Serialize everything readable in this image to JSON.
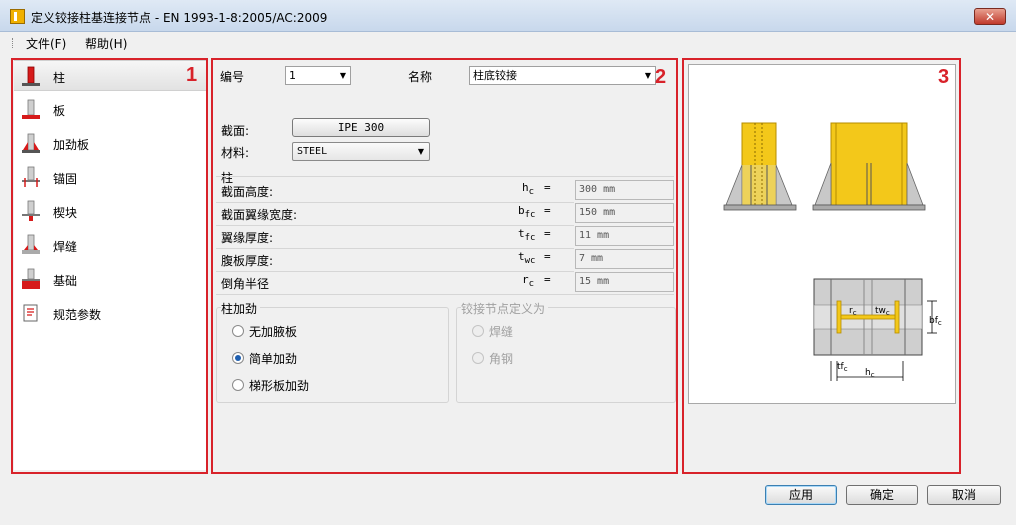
{
  "window": {
    "title": "定义铰接柱基连接节点 - EN 1993-1-8:2005/AC:2009"
  },
  "menu": {
    "file": "文件(F)",
    "help": "帮助(H)"
  },
  "annotations": [
    "1",
    "2",
    "3"
  ],
  "nav": {
    "items": [
      {
        "label": "柱",
        "icon": "column-icon",
        "selected": true
      },
      {
        "label": "板",
        "icon": "plate-icon"
      },
      {
        "label": "加劲板",
        "icon": "stiffener-icon"
      },
      {
        "label": "锚固",
        "icon": "anchor-icon"
      },
      {
        "label": "楔块",
        "icon": "shear-key-icon"
      },
      {
        "label": "焊缝",
        "icon": "weld-icon"
      },
      {
        "label": "基础",
        "icon": "foundation-icon"
      },
      {
        "label": "规范参数",
        "icon": "code-params-icon"
      }
    ]
  },
  "form": {
    "number_label": "编号",
    "number_value": "1",
    "name_label": "名称",
    "name_value": "柱底铰接",
    "section_label": "截面:",
    "section_value": "IPE 300",
    "material_label": "材料:",
    "material_value": "STEEL",
    "column_group": "柱",
    "props": [
      {
        "label": "截面高度:",
        "sym": "h",
        "sub": "c",
        "value": "300 mm"
      },
      {
        "label": "截面翼缘宽度:",
        "sym": "b",
        "sub": "fc",
        "value": "150 mm"
      },
      {
        "label": "翼缘厚度:",
        "sym": "t",
        "sub": "fc",
        "value": "11 mm"
      },
      {
        "label": "腹板厚度:",
        "sym": "t",
        "sub": "wc",
        "value": "7 mm"
      },
      {
        "label": "倒角半径",
        "sym": "r",
        "sub": "c",
        "value": "15 mm"
      }
    ],
    "eq": "=",
    "stiffening": {
      "title": "柱加劲",
      "options": [
        "无加腋板",
        "简单加劲",
        "梯形板加劲"
      ],
      "selected": 1
    },
    "joint_def": {
      "title": "铰接节点定义为",
      "options": [
        "焊缝",
        "角钢"
      ]
    }
  },
  "preview": {
    "labels": {
      "rc": "r",
      "rc_sub": "c",
      "twc": "tw",
      "twc_sub": "c",
      "bfc": "bf",
      "bfc_sub": "c",
      "tfc": "tf",
      "tfc_sub": "c",
      "hc": "h",
      "hc_sub": "c"
    },
    "colors": {
      "steel": "#f3c81a",
      "steel_edge": "#b58c00",
      "plate": "#d0d0d0",
      "concrete": "#9a9a9a"
    }
  },
  "buttons": {
    "apply": "应用",
    "ok": "确定",
    "cancel": "取消"
  },
  "colors": {
    "annotation": "#d8222a",
    "nav_accent": "#d61a1a"
  }
}
